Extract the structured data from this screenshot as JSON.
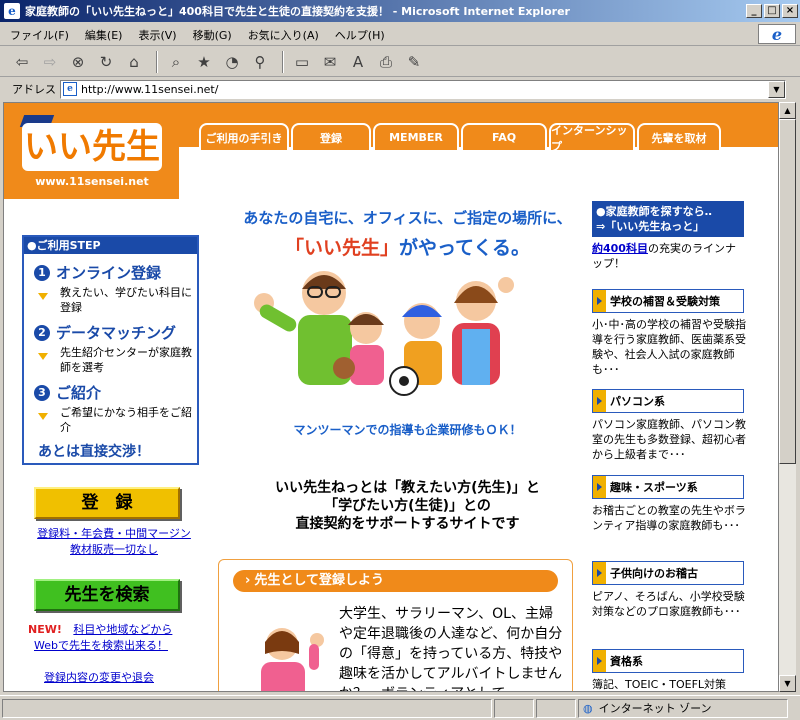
{
  "window": {
    "title": "家庭教師の「いい先生ねっと」400科目で先生と生徒の直接契約を支援！ - Microsoft Internet Explorer",
    "min": "_",
    "max": "□",
    "close": "×"
  },
  "menu": [
    "ファイル(F)",
    "編集(E)",
    "表示(V)",
    "移動(G)",
    "お気に入り(A)",
    "ヘルプ(H)"
  ],
  "address": {
    "label": "アドレス",
    "url": "http://www.11sensei.net/"
  },
  "status": {
    "zone": "インターネット ゾーン"
  },
  "site": {
    "logo_text": "いい先生",
    "logo_url": "www.11sensei.net",
    "nav": [
      "ご利用の手引き",
      "登録",
      "MEMBER",
      "FAQ",
      "インターンシップ",
      "先輩を取材"
    ],
    "steps_title": "●ご利用STEP",
    "steps": [
      {
        "num": "1",
        "title": "オンライン登録",
        "desc": "教えたい、学びたい科目に登録"
      },
      {
        "num": "2",
        "title": "データマッチング",
        "desc": "先生紹介センターが家庭教師を選考"
      },
      {
        "num": "3",
        "title": "ご紹介",
        "desc": "ご希望にかなう相手をご紹介"
      }
    ],
    "steps_final": "あとは直接交渉！",
    "register_btn": "登　録",
    "register_link1": "登録料・年会費・中間マージン",
    "register_link2": "教材販売一切なし",
    "search_btn": "先生を検索",
    "new_badge": "NEW!",
    "search_link1": "科目や地域などから",
    "search_link2": "Webで先生を検索出来る！",
    "change_link": "登録内容の変更や退会",
    "tagline1": "あなたの自宅に、オフィスに、ご指定の場所に、",
    "tagline2a": "「いい先生」",
    "tagline2b": "がやってくる。",
    "mantoman": "マンツーマンでの指導も企業研修もＯＫ！",
    "intro1": "いい先生ねっとは「教えたい方(先生)」と",
    "intro2": "「学びたい方(生徒)」との",
    "intro3": "直接契約をサポートするサイトです",
    "reg_head": "先生として登録しよう",
    "reg_text": "大学生、サラリーマン、OL、主婦や定年退職後の人達など、何か自分の「得意」を持っている方、特技や趣味を活かしてアルバイトしませんか？　ボランティアとして",
    "right": {
      "find_head1": "●家庭教師を探すなら‥",
      "find_head2": "⇒「いい先生ねっと」",
      "find_link": "約400科目",
      "find_text": "の充実のラインナップ！",
      "cats": [
        {
          "title": "学校の補習＆受験対策",
          "text": "小･中･高の学校の補習や受験指導を行う家庭教師、医歯薬系受験や、社会人入試の家庭教師も･･･"
        },
        {
          "title": "パソコン系",
          "text": "パソコン家庭教師、パソコン教室の先生も多数登録、超初心者から上級者まで･･･"
        },
        {
          "title": "趣味・スポーツ系",
          "text": "お稽古ごとの教室の先生やボランティア指導の家庭教師も･･･"
        },
        {
          "title": "子供向けのお稽古",
          "text": "ピアノ、そろばん、小学校受験対策などのプロ家庭教師も･･･"
        },
        {
          "title": "資格系",
          "text": "簿記、TOEIC・TOEFL対策"
        }
      ]
    }
  },
  "colors": {
    "orange": "#f08a1a",
    "blue": "#1a4aa8",
    "yellow": "#f0c000",
    "green": "#40c020"
  }
}
